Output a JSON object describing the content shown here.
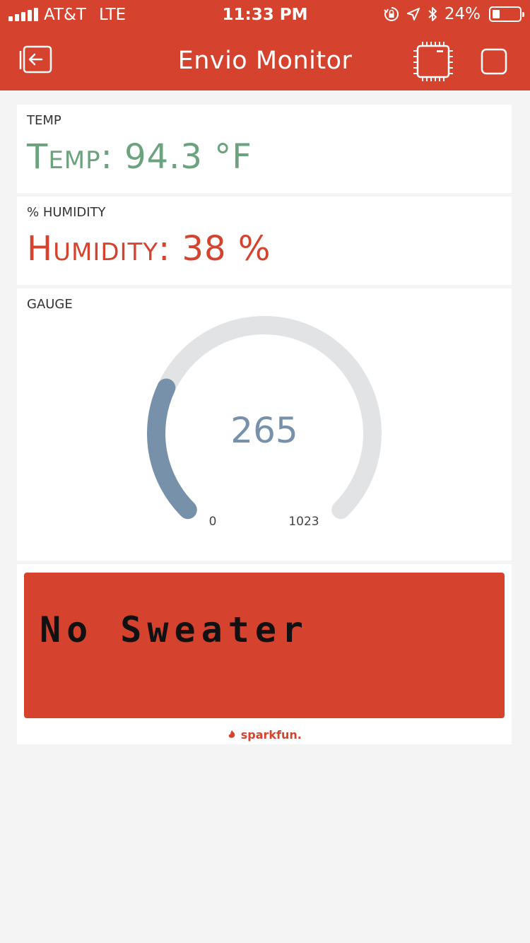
{
  "status_bar": {
    "carrier": "AT&T",
    "network": "LTE",
    "time": "11:33 PM",
    "battery_percent": "24%",
    "battery_level": 0.24,
    "icons": [
      "signal-icon",
      "rotation-lock-icon",
      "location-arrow-icon",
      "bluetooth-icon",
      "battery-icon"
    ]
  },
  "nav": {
    "title": "Envio Monitor",
    "icons": [
      "exit-icon",
      "device-chip-icon",
      "stop-square-icon"
    ]
  },
  "temp_widget": {
    "label": "TEMP",
    "value_text": "Temp: 94.3 °F",
    "color": "#6aa37e"
  },
  "humidity_widget": {
    "label": "% HUMIDITY",
    "value_text": "Humidity: 38 %",
    "color": "#d5432f"
  },
  "gauge_widget": {
    "label": "GAUGE",
    "value": 265,
    "value_text": "265",
    "min": 0,
    "max": 1023,
    "min_label": "0",
    "max_label": "1023",
    "color": "#7791aa"
  },
  "lcd_widget": {
    "text": "No Sweater",
    "background": "#d5432f"
  },
  "branding": {
    "text": "sparkfun."
  }
}
